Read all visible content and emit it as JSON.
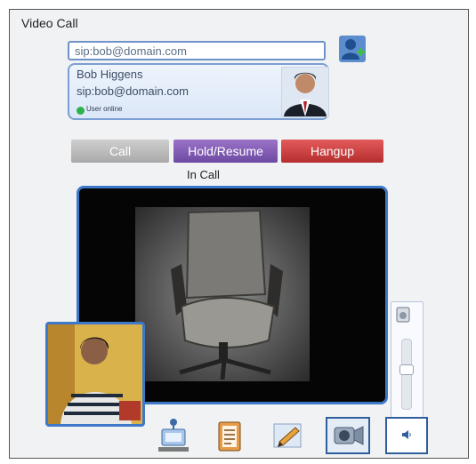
{
  "window": {
    "title": "Video Call"
  },
  "dial": {
    "sip_value": "sip:bob@domain.com"
  },
  "contact": {
    "name": "Bob Higgens",
    "sip": "sip:bob@domain.com",
    "status": "User online"
  },
  "controls": {
    "call_label": "Call",
    "hold_label": "Hold/Resume",
    "hangup_label": "Hangup"
  },
  "call_state": "In Call",
  "icons": {
    "add_contact": "add-contact-icon",
    "network": "network-icon",
    "notes": "notes-icon",
    "whiteboard": "whiteboard-icon",
    "camera": "camera-icon",
    "speaker": "speaker-icon",
    "volume_top": "speaker-volume-icon"
  },
  "colors": {
    "accent_border": "#3e78c9",
    "hold_button": "#7b55b2",
    "hangup_button": "#c73b3b",
    "call_button": "#bdbdbd",
    "online_status": "#2db24b"
  }
}
